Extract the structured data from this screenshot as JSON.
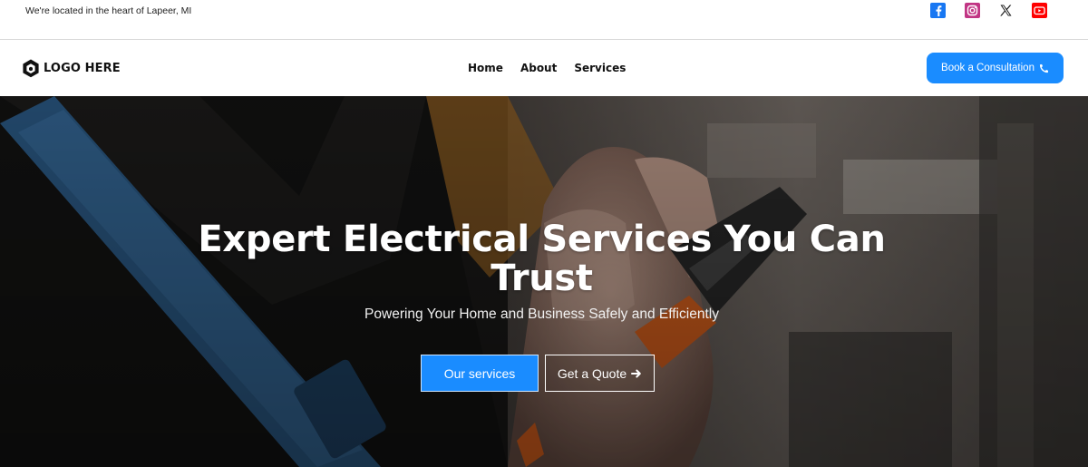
{
  "topbar": {
    "location": "We're located in the heart of Lapeer, MI",
    "social": [
      {
        "icon": "facebook-icon",
        "color": "#1877f2"
      },
      {
        "icon": "instagram-icon",
        "color": "#c13584"
      },
      {
        "icon": "x-twitter-icon",
        "color": "#000000"
      },
      {
        "icon": "youtube-icon",
        "color": "#ff0000"
      }
    ]
  },
  "header": {
    "logo_text": "LOGO HERE",
    "nav": [
      "Home",
      "About",
      "Services"
    ],
    "cta_label": "Book a Consultation",
    "cta_icon": "phone-icon"
  },
  "hero": {
    "title_line1": "Expert Electrical Services You Can",
    "title_line2": "Trust",
    "subtitle": "Powering Your Home and Business Safely and Efficiently",
    "primary_button": "Our services",
    "secondary_button": "Get a Quote",
    "secondary_icon": "arrow-right-icon"
  },
  "colors": {
    "accent": "#1a8cff",
    "text": "#111111",
    "hero_text": "#ffffff"
  }
}
